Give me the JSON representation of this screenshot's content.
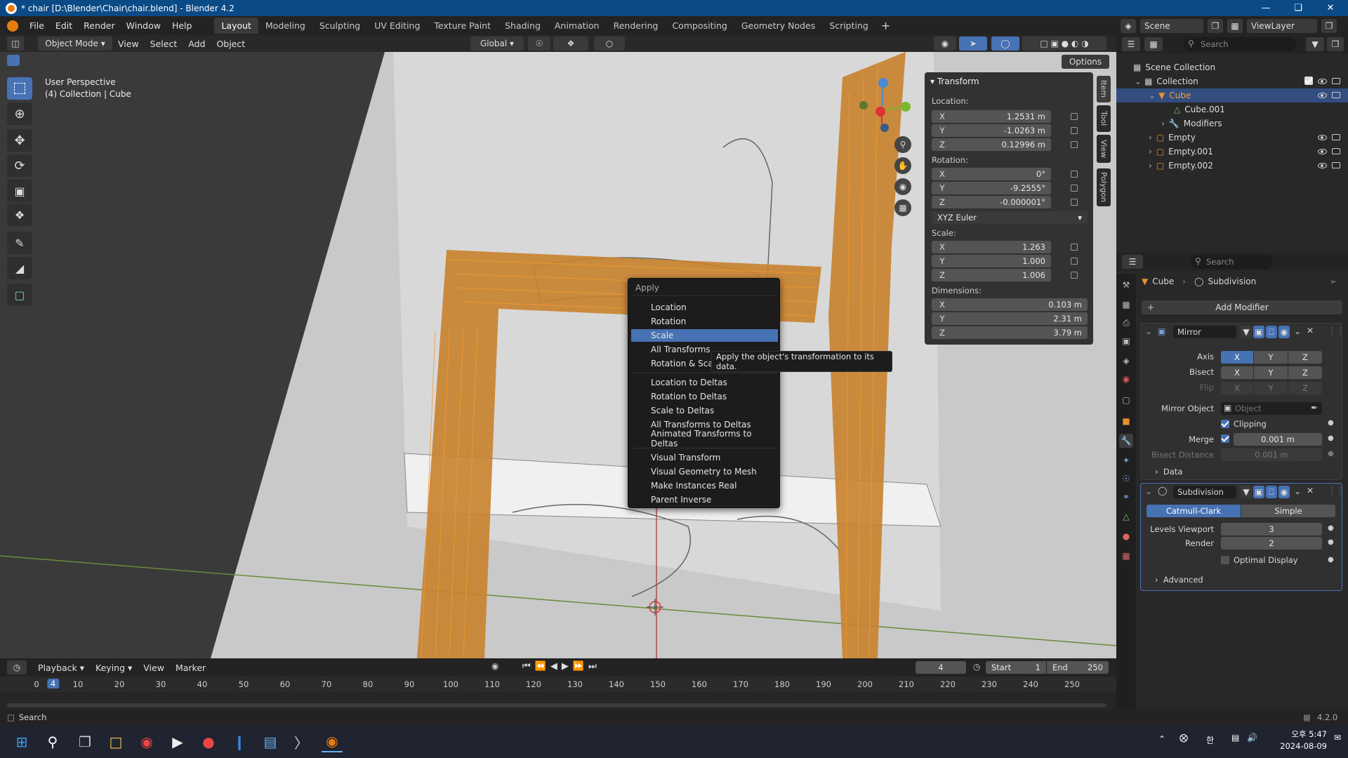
{
  "titlebar": {
    "title": "* chair [D:\\Blender\\Chair\\chair.blend] - Blender 4.2"
  },
  "menu": [
    "File",
    "Edit",
    "Render",
    "Window",
    "Help"
  ],
  "workspaces": [
    "Layout",
    "Modeling",
    "Sculpting",
    "UV Editing",
    "Texture Paint",
    "Shading",
    "Animation",
    "Rendering",
    "Compositing",
    "Geometry Nodes",
    "Scripting"
  ],
  "scene": {
    "scene_name": "Scene",
    "view_layer": "ViewLayer"
  },
  "viewport_header": {
    "mode": "Object Mode",
    "menus": [
      "View",
      "Select",
      "Add",
      "Object"
    ],
    "orientation": "Global",
    "options": "Options"
  },
  "viewport_info": {
    "line1": "User Perspective",
    "line2": "(4) Collection | Cube"
  },
  "sidebar_tabs": [
    "Item",
    "Tool",
    "View",
    "Polygon"
  ],
  "transform": {
    "title": "Transform",
    "location_label": "Location:",
    "location": [
      {
        "axis": "X",
        "value": "1.2531 m"
      },
      {
        "axis": "Y",
        "value": "-1.0263 m"
      },
      {
        "axis": "Z",
        "value": "0.12996 m"
      }
    ],
    "rotation_label": "Rotation:",
    "rotation": [
      {
        "axis": "X",
        "value": "0°"
      },
      {
        "axis": "Y",
        "value": "-9.2555°"
      },
      {
        "axis": "Z",
        "value": "-0.000001°"
      }
    ],
    "rotation_mode": "XYZ Euler",
    "scale_label": "Scale:",
    "scale": [
      {
        "axis": "X",
        "value": "1.263"
      },
      {
        "axis": "Y",
        "value": "1.000"
      },
      {
        "axis": "Z",
        "value": "1.006"
      }
    ],
    "dimensions_label": "Dimensions:",
    "dimensions": [
      {
        "axis": "X",
        "value": "0.103 m"
      },
      {
        "axis": "Y",
        "value": "2.31 m"
      },
      {
        "axis": "Z",
        "value": "3.79 m"
      }
    ]
  },
  "context_menu": {
    "title": "Apply",
    "items": [
      "Location",
      "Rotation",
      "Scale",
      "All Transforms",
      "Rotation & Scal",
      "Location to Deltas",
      "Rotation to Deltas",
      "Scale to Deltas",
      "All Transforms to Deltas",
      "Animated Transforms to Deltas",
      "Visual Transform",
      "Visual Geometry to Mesh",
      "Make Instances Real",
      "Parent Inverse"
    ],
    "active_item": "Scale",
    "tooltip": "Apply the object's transformation to its data."
  },
  "outliner": {
    "search_placeholder": "Search",
    "rows": [
      "Scene Collection",
      "Collection",
      "Cube",
      "Cube.001",
      "Modifiers",
      "Empty",
      "Empty.001",
      "Empty.002"
    ]
  },
  "properties": {
    "search_placeholder": "Search",
    "breadcrumb_object": "Cube",
    "breadcrumb_modifier": "Subdivision",
    "add_modifier": "Add Modifier",
    "mirror": {
      "name": "Mirror",
      "axis_label": "Axis",
      "bisect_label": "Bisect",
      "flip_label": "Flip",
      "axes": [
        "X",
        "Y",
        "Z"
      ],
      "mirror_object_label": "Mirror Object",
      "mirror_object_placeholder": "Object",
      "clipping_label": "Clipping",
      "merge_label": "Merge",
      "merge_value": "0.001 m",
      "bisect_distance_label": "Bisect Distance",
      "bisect_distance_value": "0.001 m",
      "data_label": "Data"
    },
    "subdivision": {
      "name": "Subdivision",
      "catmull": "Catmull-Clark",
      "simple": "Simple",
      "levels_viewport_label": "Levels Viewport",
      "levels_viewport": "3",
      "render_label": "Render",
      "render": "2",
      "optimal_label": "Optimal Display",
      "advanced_label": "Advanced"
    }
  },
  "timeline": {
    "menus": [
      "Playback",
      "Keying",
      "View",
      "Marker"
    ],
    "current_frame": "4",
    "start_label": "Start",
    "start": "1",
    "end_label": "End",
    "end": "250",
    "ticks": [
      "0",
      "10",
      "20",
      "30",
      "40",
      "50",
      "60",
      "70",
      "80",
      "90",
      "100",
      "110",
      "120",
      "130",
      "140",
      "150",
      "160",
      "170",
      "180",
      "190",
      "200",
      "210",
      "220",
      "230",
      "240",
      "250"
    ],
    "playhead": "4"
  },
  "statusbar": {
    "left": "Search",
    "version": "4.2.0"
  },
  "taskbar": {
    "time": "오후 5:47",
    "date": "2024-08-09",
    "ime": "한"
  },
  "colors": {
    "accent": "#4772b3",
    "wire": "#e87d0d",
    "viewport_bg": "#3d3d3d"
  }
}
